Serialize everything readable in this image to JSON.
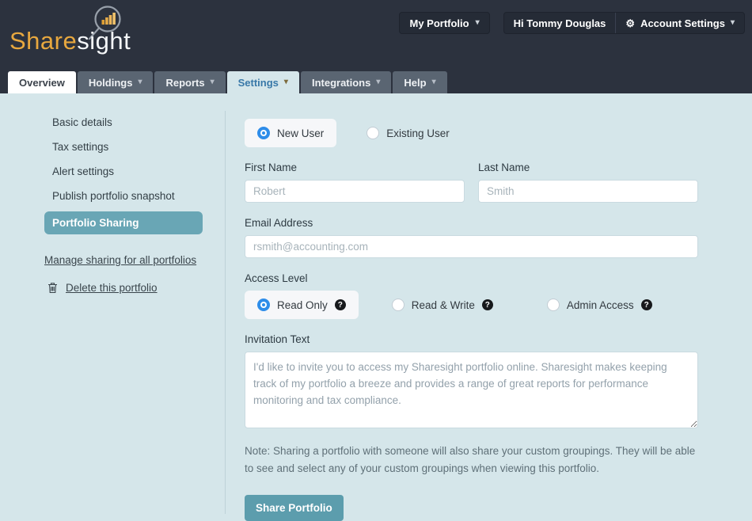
{
  "colors": {
    "header_bg": "#2c323e",
    "body_bg": "#d5e6ea",
    "tab_inactive_bg": "#5a6572",
    "settings_tab_text": "#3878a8",
    "active_sidebar_teal": "#69a6b5",
    "submit_button_teal": "#5c9dad",
    "radio_selected_blue": "#2e8de9",
    "logo_gold": "#e8a83f"
  },
  "icons": {
    "chevron_down": "▾",
    "gear": "⚙",
    "help": "?"
  },
  "header": {
    "logo_part1": "Share",
    "logo_part2": "sight",
    "my_portfolio_label": "My Portfolio",
    "greeting": "Hi Tommy Douglas",
    "account_settings_label": "Account Settings"
  },
  "nav": {
    "tabs": [
      {
        "label": "Overview",
        "state": "active-page"
      },
      {
        "label": "Holdings",
        "state": "normal"
      },
      {
        "label": "Reports",
        "state": "normal"
      },
      {
        "label": "Settings",
        "state": "current-section"
      },
      {
        "label": "Integrations",
        "state": "normal"
      },
      {
        "label": "Help",
        "state": "normal"
      }
    ]
  },
  "sidebar": {
    "items": [
      {
        "label": "Basic details",
        "active": false
      },
      {
        "label": "Tax settings",
        "active": false
      },
      {
        "label": "Alert settings",
        "active": false
      },
      {
        "label": "Publish portfolio snapshot",
        "active": false
      },
      {
        "label": "Portfolio Sharing",
        "active": true
      }
    ],
    "manage_link": "Manage sharing for all portfolios",
    "delete_link": "Delete this portfolio"
  },
  "form": {
    "user_type": {
      "new_user_label": "New User",
      "existing_user_label": "Existing User",
      "selected": "New User"
    },
    "first_name": {
      "label": "First Name",
      "placeholder": "Robert",
      "value": ""
    },
    "last_name": {
      "label": "Last Name",
      "placeholder": "Smith",
      "value": ""
    },
    "email": {
      "label": "Email Address",
      "placeholder": "rsmith@accounting.com",
      "value": ""
    },
    "access_level": {
      "label": "Access Level",
      "options": [
        {
          "label": "Read Only"
        },
        {
          "label": "Read & Write"
        },
        {
          "label": "Admin Access"
        }
      ],
      "selected": "Read Only"
    },
    "invitation": {
      "label": "Invitation Text",
      "value": "I'd like to invite you to access my Sharesight portfolio online. Sharesight makes keeping track of my portfolio a breeze and provides a range of great reports for performance monitoring and tax compliance."
    },
    "note": "Note: Sharing a portfolio with someone will also share your custom groupings. They will be able to see and select any of your custom groupings when viewing this portfolio.",
    "submit_label": "Share Portfolio"
  }
}
